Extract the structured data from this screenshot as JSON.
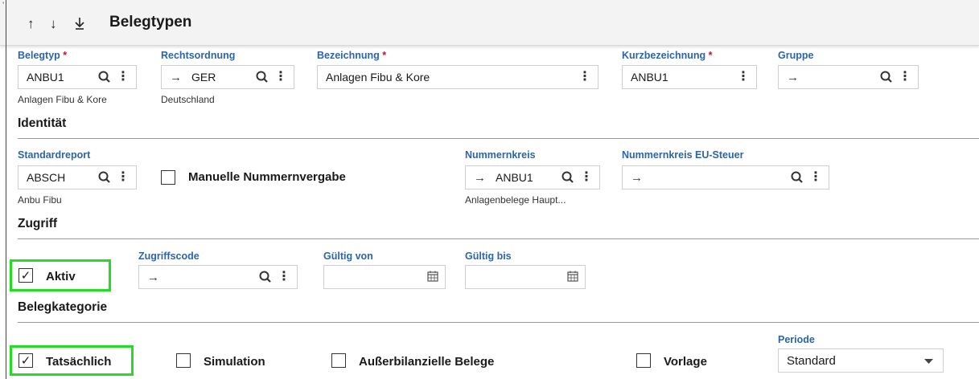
{
  "header": {
    "title": "Belegtypen"
  },
  "toolbar": {
    "icons": [
      "arrow-up-icon",
      "arrow-down-icon",
      "download-icon"
    ],
    "up_glyph": "↑",
    "down_glyph": "↓",
    "download_glyph": "⭳"
  },
  "top_row": {
    "belegtyp": {
      "label": "Belegtyp",
      "required": "*",
      "value": "ANBU1",
      "description": "Anlagen Fibu & Kore"
    },
    "rechtsordnung": {
      "label": "Rechtsordnung",
      "value": "GER",
      "description": "Deutschland"
    },
    "bezeichnung": {
      "label": "Bezeichnung",
      "required": "*",
      "value": "Anlagen Fibu & Kore"
    },
    "kurzbezeichnung": {
      "label": "Kurzbezeichnung",
      "required": "*",
      "value": "ANBU1"
    },
    "gruppe": {
      "label": "Gruppe",
      "value": ""
    }
  },
  "identitaet": {
    "title": "Identität",
    "standardreport": {
      "label": "Standardreport",
      "value": "ABSCH",
      "description": "Anbu Fibu"
    },
    "manuelle": {
      "label": "Manuelle Nummernvergabe",
      "checked": false
    },
    "nummernkreis": {
      "label": "Nummernkreis",
      "value": "ANBU1",
      "description": "Anlagenbelege Haupt..."
    },
    "nummernkreis_eu": {
      "label": "Nummernkreis EU-Steuer",
      "value": ""
    }
  },
  "zugriff": {
    "title": "Zugriff",
    "aktiv": {
      "label": "Aktiv",
      "checked": true
    },
    "zugriffscode": {
      "label": "Zugriffscode",
      "value": ""
    },
    "gueltig_von": {
      "label": "Gültig von",
      "value": ""
    },
    "gueltig_bis": {
      "label": "Gültig bis",
      "value": ""
    }
  },
  "belegkategorie": {
    "title": "Belegkategorie",
    "tatsaechlich": {
      "label": "Tatsächlich",
      "checked": true
    },
    "simulation": {
      "label": "Simulation",
      "checked": false
    },
    "ausserbilanziell": {
      "label": "Außerbilanzielle Belege",
      "checked": false
    },
    "vorlage": {
      "label": "Vorlage",
      "checked": false
    },
    "periode": {
      "label": "Periode",
      "value": "Standard",
      "options": [
        "Standard"
      ]
    }
  },
  "glyphs": {
    "arrow": "→",
    "kebab": "⋮",
    "calendar": "▦",
    "check": "✓",
    "caret": "▾"
  },
  "colors": {
    "label_blue": "#2e64a8",
    "required_red": "#c8102e",
    "highlight_green": "#22dd22"
  }
}
